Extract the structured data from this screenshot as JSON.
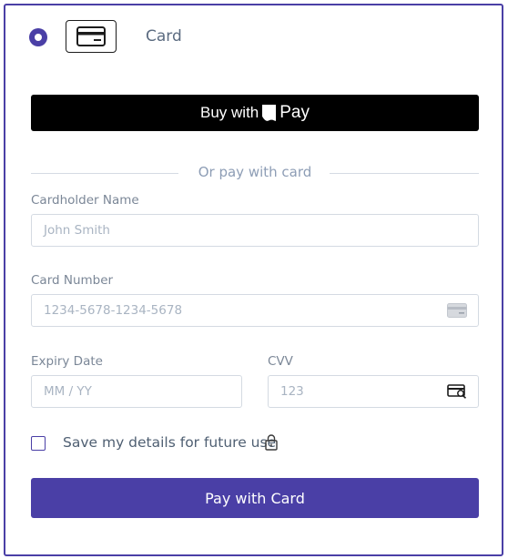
{
  "payment_method": {
    "label": "Card",
    "icon": "credit-card-icon",
    "selected": true
  },
  "apple_pay": {
    "prefix": "Buy with",
    "logo": "apple-logo-icon",
    "pay_word": "Pay"
  },
  "divider": {
    "text": "Or pay with card"
  },
  "form": {
    "cardholder_name": {
      "label": "Cardholder Name",
      "placeholder": "John Smith"
    },
    "card_number": {
      "label": "Card Number",
      "placeholder": "1234-5678-1234-5678",
      "icon": "card-icon"
    },
    "expiry_date": {
      "label": "Expiry Date",
      "placeholder": "MM / YY"
    },
    "cvv": {
      "label": "CVV",
      "placeholder": "123",
      "icon": "card-cvv-icon"
    }
  },
  "save_details": {
    "label": "Save my details for future use",
    "checked": false,
    "icon": "lock-icon"
  },
  "submit": {
    "label": "Pay with Card"
  },
  "colors": {
    "accent": "#4a3fa6",
    "apple_pay_bg": "#000000"
  }
}
